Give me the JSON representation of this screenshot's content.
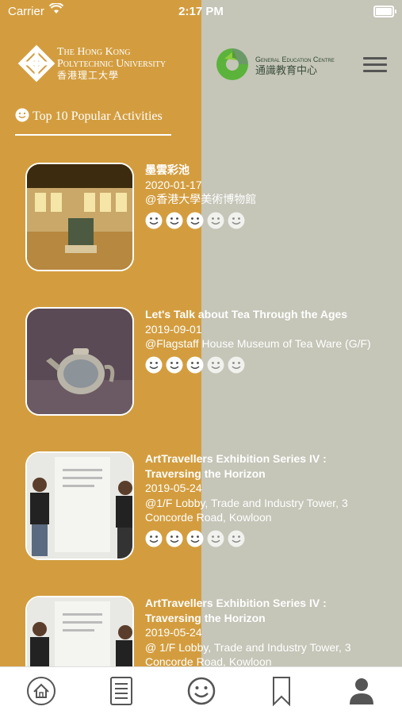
{
  "status": {
    "carrier": "Carrier",
    "time": "2:17 PM"
  },
  "header": {
    "polyu": {
      "line1": "The Hong Kong",
      "line2": "Polytechnic University",
      "cn": "香港理工大學"
    },
    "gec": {
      "en": "General Education Centre",
      "cn": "通識教育中心"
    },
    "menu_icon": "hamburger-icon"
  },
  "section": {
    "title": "Top 10 Popular Activities",
    "icon": "smiley-icon"
  },
  "activities": [
    {
      "title": "墨雲彩池",
      "date": "2020-01-17",
      "venue": "@香港大學美術博物館",
      "rating": 3,
      "thumb": "museum-gallery"
    },
    {
      "title": "Let's Talk about Tea Through the Ages",
      "date": "2019-09-01",
      "venue": "@Flagstaff House Museum of Tea Ware (G/F)",
      "rating": 3,
      "thumb": "teapot"
    },
    {
      "title": "ArtTravellers Exhibition Series IV : Traversing the Horizon",
      "date": "2019-05-24",
      "venue": "@1/F Lobby, Trade and Industry Tower, 3 Concorde Road, Kowloon",
      "rating": 3,
      "thumb": "exhibition-wall"
    },
    {
      "title": "ArtTravellers Exhibition Series IV : Traversing the Horizon",
      "date": "2019-05-24",
      "venue": "@ 1/F Lobby, Trade and Industry Tower, 3 Concorde Road, Kowloon",
      "rating": 3,
      "thumb": "exhibition-wall"
    }
  ],
  "tabs": [
    {
      "icon": "home-icon"
    },
    {
      "icon": "list-icon"
    },
    {
      "icon": "smiley-icon"
    },
    {
      "icon": "bookmark-icon"
    },
    {
      "icon": "profile-icon"
    }
  ],
  "colors": {
    "left_bg": "#d39d3f",
    "right_bg": "#c5c5b8",
    "tab_icon": "#555555"
  }
}
